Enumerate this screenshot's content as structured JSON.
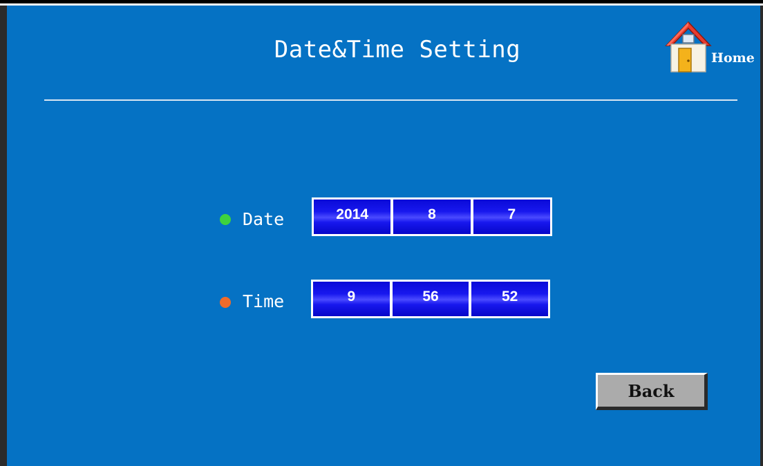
{
  "title": "Date&Time Setting",
  "home": {
    "label": "Home",
    "icon": "house-icon"
  },
  "date": {
    "label": "Date",
    "indicator_color": "#3ed33e",
    "year": "2014",
    "month": "8",
    "day": "7"
  },
  "time": {
    "label": "Time",
    "indicator_color": "#f06b2a",
    "hour": "9",
    "minute": "56",
    "second": "52"
  },
  "back_label": "Back",
  "colors": {
    "background": "#0572c4",
    "field_blue": "#1414e6",
    "button_gray": "#ababab"
  }
}
